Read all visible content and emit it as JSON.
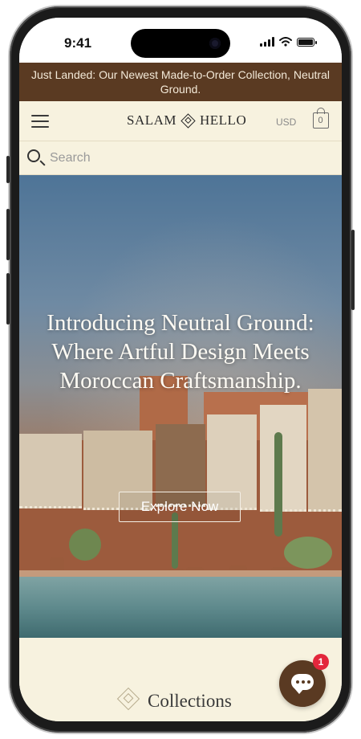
{
  "status_bar": {
    "time": "9:41"
  },
  "announcement": {
    "text": "Just Landed: Our Newest Made-to-Order Collection, Neutral Ground."
  },
  "header": {
    "logo_left": "SALAM",
    "logo_right": "HELLO",
    "currency": "USD",
    "cart_count": "0"
  },
  "search": {
    "placeholder": "Search"
  },
  "hero": {
    "title": "Introducing Neutral Ground: Where Artful Design Meets Moroccan Craftsmanship.",
    "cta_label": "Explore Now"
  },
  "collections": {
    "title": "Collections"
  },
  "chat": {
    "badge_count": "1"
  },
  "colors": {
    "announcement_bg": "#5a3a22",
    "header_bg": "#f7f2df",
    "chat_badge": "#e3273c"
  }
}
